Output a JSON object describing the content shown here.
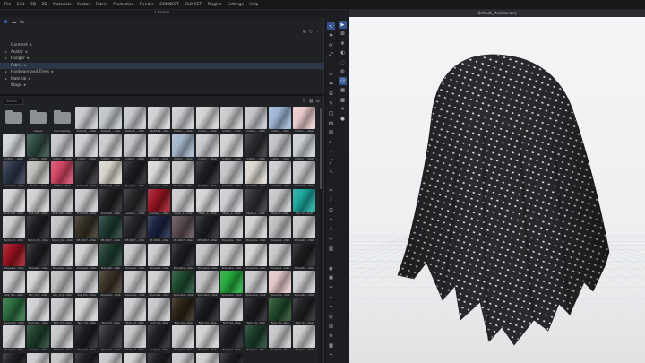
{
  "menu": [
    "File",
    "Edit",
    "3D",
    "2D",
    "Materials",
    "Avatar",
    "Fabric",
    "Production",
    "Render",
    "CONNECT",
    "CLO-SET",
    "Plugins",
    "Settings",
    "Help"
  ],
  "library": {
    "title": "Library",
    "tree": [
      {
        "label": "Garment",
        "expanded": false,
        "selected": false
      },
      {
        "label": "Avatar",
        "expanded": true,
        "selected": false
      },
      {
        "label": "Hanger",
        "expanded": true,
        "selected": false
      },
      {
        "label": "Fabric",
        "expanded": false,
        "selected": true
      },
      {
        "label": "Hardware and Trims",
        "expanded": true,
        "selected": false
      },
      {
        "label": "Material",
        "expanded": true,
        "selected": false
      },
      {
        "label": "Stage",
        "expanded": false,
        "selected": false
      }
    ],
    "search_placeholder": "Search",
    "items": [
      {
        "label": "..",
        "kind": "folder",
        "color": "#8d9093"
      },
      {
        "label": "Casual",
        "kind": "folder",
        "color": "#8d9093"
      },
      {
        "label": "Normal Map",
        "kind": "folder",
        "color": "#8d9093"
      },
      {
        "label": "Default_...zfab",
        "kind": "fabric",
        "color": "#c7c9cc"
      },
      {
        "label": "Default_...zfab",
        "kind": "fabric",
        "color": "#c2c5c8"
      },
      {
        "label": "Default_...zfab",
        "kind": "fabric",
        "color": "#c4c6c9"
      },
      {
        "label": "G6/8812...zfab",
        "kind": "fabric",
        "color": "#cfd1d3"
      },
      {
        "label": "Cotton_...zfab",
        "kind": "fabric",
        "color": "#c9cbce"
      },
      {
        "label": "Cotton_...zfab",
        "kind": "fabric",
        "color": "#d2d2d2"
      },
      {
        "label": "Cotton_...zfab",
        "kind": "fabric",
        "color": "#c7c9cb"
      },
      {
        "label": "Cotton_...zfab",
        "kind": "fabric",
        "color": "#c2c4c7"
      },
      {
        "label": "Cotton_...zfab",
        "kind": "fabric",
        "color": "#9db4d3"
      },
      {
        "label": "Cotton_...zfab",
        "kind": "fabric",
        "color": "#e8c9cb"
      },
      {
        "label": "Cotton_...zfab",
        "kind": "fabric",
        "color": "#cfd2d6"
      },
      {
        "label": "Cotton_...zfab",
        "kind": "fabric",
        "color": "#2f4a41"
      },
      {
        "label": "Cotton_...zfab",
        "kind": "fabric",
        "color": "#c3c5c8"
      },
      {
        "label": "Cotton_...zfab",
        "kind": "fabric",
        "color": "#cbcdd0"
      },
      {
        "label": "Cotton_...zfab",
        "kind": "fabric",
        "color": "#c7c9cb"
      },
      {
        "label": "Cotton_...zfab",
        "kind": "fabric",
        "color": "#c1c3c6"
      },
      {
        "label": "Cotton_...zfab",
        "kind": "fabric",
        "color": "#d0d2d4"
      },
      {
        "label": "Cotton_...zfab",
        "kind": "fabric",
        "color": "#a4b6c9"
      },
      {
        "label": "Cotton_...zfab",
        "kind": "fabric",
        "color": "#c6c8cb"
      },
      {
        "label": "Cotton_...zfab",
        "kind": "fabric",
        "color": "#cfcfcf"
      },
      {
        "label": "Cotton_...zfab",
        "kind": "fabric",
        "color": "#2b2c2f"
      },
      {
        "label": "Cotton_...zfab",
        "kind": "fabric",
        "color": "#bfc1c4"
      },
      {
        "label": "Cotton_...zfab",
        "kind": "fabric",
        "color": "#cacdd0"
      },
      {
        "label": "Denim_2...zfab",
        "kind": "fabric",
        "color": "#2c3447"
      },
      {
        "label": "DS Tec...zfab",
        "kind": "fabric",
        "color": "#bfbfb9"
      },
      {
        "label": "FEE19...zfab",
        "kind": "fabric",
        "color": "#d24563"
      },
      {
        "label": "Fabric_D...zfab",
        "kind": "fabric",
        "color": "#2a2a2e"
      },
      {
        "label": "Fabric_D...zfab",
        "kind": "fabric",
        "color": "#d6d3c8"
      },
      {
        "label": "Fur_Plus...zfab",
        "kind": "fabric",
        "color": "#1d1e21"
      },
      {
        "label": "Fur_Plus...zfab",
        "kind": "fabric",
        "color": "#d8d8d8"
      },
      {
        "label": "Fur_Plus...zfab",
        "kind": "fabric",
        "color": "#c4c4c4"
      },
      {
        "label": "Fur_Fab...zfab",
        "kind": "fabric",
        "color": "#1f2023"
      },
      {
        "label": "Knit Pati...zfab",
        "kind": "fabric",
        "color": "#c2c4c6"
      },
      {
        "label": "Knit Pati...zfab",
        "kind": "fabric",
        "color": "#d9d7cf"
      },
      {
        "label": "Knit Pati...zfab",
        "kind": "fabric",
        "color": "#c9cbcd"
      },
      {
        "label": "Knit Pati...zfab",
        "kind": "fabric",
        "color": "#c6c8ca"
      },
      {
        "label": "Knit Pati...zfab",
        "kind": "fabric",
        "color": "#d0d2d4"
      },
      {
        "label": "Knit Pati...zfab",
        "kind": "fabric",
        "color": "#cfcfcf"
      },
      {
        "label": "Knit Pati...zfab",
        "kind": "fabric",
        "color": "#bfc1c3"
      },
      {
        "label": "Knit Pati...zfab",
        "kind": "fabric",
        "color": "#c8cacc"
      },
      {
        "label": "Knit Pati...zfab",
        "kind": "fabric",
        "color": "#1d1f21"
      },
      {
        "label": "Leather_...zfab",
        "kind": "fabric",
        "color": "#28292b"
      },
      {
        "label": "Leather_...zfab",
        "kind": "fabric",
        "color": "#9a1522"
      },
      {
        "label": "Mesh_L...zfab",
        "kind": "fabric",
        "color": "#c8cacb"
      },
      {
        "label": "Mesh_L...zfab",
        "kind": "fabric",
        "color": "#d2d2d2"
      },
      {
        "label": "Mesh_L...zfab",
        "kind": "fabric",
        "color": "#cccdd0"
      },
      {
        "label": "Mesh_L...zfab",
        "kind": "fabric",
        "color": "#2d2e31"
      },
      {
        "label": "Mesh_F...zfab",
        "kind": "fabric",
        "color": "#c4c6c8"
      },
      {
        "label": "Neo Pl...zfab",
        "kind": "fabric",
        "color": "#1aa59b"
      },
      {
        "label": "Nylon_C...zfab",
        "kind": "fabric",
        "color": "#c9cbcc"
      },
      {
        "label": "Nylon_Pe...zfab",
        "kind": "fabric",
        "color": "#1e1f22"
      },
      {
        "label": "Nylon_Pe...zfab",
        "kind": "fabric",
        "color": "#c1c3c5"
      },
      {
        "label": "PE-0607...zfab",
        "kind": "fabric",
        "color": "#353024"
      },
      {
        "label": "PE-0607...zfab",
        "kind": "fabric",
        "color": "#1e3a32"
      },
      {
        "label": "PE-0607...zfab",
        "kind": "fabric",
        "color": "#23252a"
      },
      {
        "label": "PE-0609...zfab",
        "kind": "fabric",
        "color": "#1b2340"
      },
      {
        "label": "PE-0607...zfab",
        "kind": "fabric",
        "color": "#5b4e53"
      },
      {
        "label": "PE-0607...zfab",
        "kind": "fabric",
        "color": "#1d1f22"
      },
      {
        "label": "Polyeste...zfab",
        "kind": "fabric",
        "color": "#c7c9cb"
      },
      {
        "label": "Polyeste...zfab",
        "kind": "fabric",
        "color": "#d1d1d1"
      },
      {
        "label": "Polyeste...zfab",
        "kind": "fabric",
        "color": "#bbbdbf"
      },
      {
        "label": "Polyeste...zfab",
        "kind": "fabric",
        "color": "#c6c6c6"
      },
      {
        "label": "Polyeste...zfab",
        "kind": "fabric",
        "color": "#9b1220"
      },
      {
        "label": "Polyeste...zfab",
        "kind": "fabric",
        "color": "#1d1e21"
      },
      {
        "label": "Polyeste...zfab",
        "kind": "fabric",
        "color": "#c8cacc"
      },
      {
        "label": "Polyeste...zfab",
        "kind": "fabric",
        "color": "#d0d0d0"
      },
      {
        "label": "Polyeste...zfab",
        "kind": "fabric",
        "color": "#1e3b2f"
      },
      {
        "label": "Polyeste...zfab",
        "kind": "fabric",
        "color": "#c6c8ca"
      },
      {
        "label": "Polyeste...zfab",
        "kind": "fabric",
        "color": "#c9cbcd"
      },
      {
        "label": "Polyeste...zfab",
        "kind": "fabric",
        "color": "#1e1f22"
      },
      {
        "label": "Polyeste...zfab",
        "kind": "fabric",
        "color": "#c2c4c6"
      },
      {
        "label": "Polyeste...zfab",
        "kind": "fabric",
        "color": "#cacaca"
      },
      {
        "label": "Polyeste...zfab",
        "kind": "fabric",
        "color": "#d3d3d3"
      },
      {
        "label": "Polyeste...zfab",
        "kind": "fabric",
        "color": "#c5c7c9"
      },
      {
        "label": "Polyeste...zfab",
        "kind": "fabric",
        "color": "#1d1e20"
      },
      {
        "label": "Silk_Pla...zfab",
        "kind": "fabric",
        "color": "#c9cbcd"
      },
      {
        "label": "Silk_Org...zfab",
        "kind": "fabric",
        "color": "#d4d4d4"
      },
      {
        "label": "Silk_Org...zfab",
        "kind": "fabric",
        "color": "#bebebe"
      },
      {
        "label": "Silk_Pla...zfab",
        "kind": "fabric",
        "color": "#c6c8ca"
      },
      {
        "label": "Spandex...zfab",
        "kind": "fabric",
        "color": "#3a3327"
      },
      {
        "label": "Spandex...zfab",
        "kind": "fabric",
        "color": "#c8cacc"
      },
      {
        "label": "Spandex...zfab",
        "kind": "fabric",
        "color": "#cfcfcf"
      },
      {
        "label": "Spandex...zfab",
        "kind": "fabric",
        "color": "#1e4b2e"
      },
      {
        "label": "Spandex...zfab",
        "kind": "fabric",
        "color": "#c2c2c2"
      },
      {
        "label": "Spandex...zfab",
        "kind": "fabric",
        "color": "#23a83a"
      },
      {
        "label": "Spandex...zfab",
        "kind": "fabric",
        "color": "#c7c9cb"
      },
      {
        "label": "Spandex...zfab",
        "kind": "fabric",
        "color": "#e2c6c8"
      },
      {
        "label": "Spandex...zfab",
        "kind": "fabric",
        "color": "#cbcdcf"
      },
      {
        "label": "Spandex...zfab",
        "kind": "fabric",
        "color": "#2a6c3d"
      },
      {
        "label": "Spandex...zfab",
        "kind": "fabric",
        "color": "#cfd1d3"
      },
      {
        "label": "Twill_Sil...zfab",
        "kind": "fabric",
        "color": "#c5c7c9"
      },
      {
        "label": "Twill_Sil...zfab",
        "kind": "fabric",
        "color": "#d3d3d3"
      },
      {
        "label": "Twill_Sil...zfab",
        "kind": "fabric",
        "color": "#1e1f22"
      },
      {
        "label": "Twill_Sil...zfab",
        "kind": "fabric",
        "color": "#c7c9cb"
      },
      {
        "label": "Twill_Sil...zfab",
        "kind": "fabric",
        "color": "#c3c5c7"
      },
      {
        "label": "Twill_Sil...zfab",
        "kind": "fabric",
        "color": "#2b2215"
      },
      {
        "label": "Twill_Sil...zfab",
        "kind": "fabric",
        "color": "#1b1c1f"
      },
      {
        "label": "Twill_Sil...zfab",
        "kind": "fabric",
        "color": "#c6c8ca"
      },
      {
        "label": "Twill_Sil...zfab",
        "kind": "fabric",
        "color": "#1c1d20"
      },
      {
        "label": "Twill_Sil...zfab",
        "kind": "fabric",
        "color": "#214a2a"
      },
      {
        "label": "Twill_Sil...zfab",
        "kind": "fabric",
        "color": "#1e2022"
      },
      {
        "label": "Twill_Sil...zfab",
        "kind": "fabric",
        "color": "#cbcdcf"
      },
      {
        "label": "Twill_Sil...zfab",
        "kind": "fabric",
        "color": "#1d3d2b"
      },
      {
        "label": "Twill_Sil...zfab",
        "kind": "fabric",
        "color": "#c4c6c8"
      },
      {
        "label": "Twill_Sil...zfab",
        "kind": "fabric",
        "color": "#1b1c1f"
      },
      {
        "label": "Twill_Sil...zfab",
        "kind": "fabric",
        "color": "#2c2d30"
      },
      {
        "label": "Twill_Sil...zfab",
        "kind": "fabric",
        "color": "#c2c4c6"
      },
      {
        "label": "Twill_Sil...zfab",
        "kind": "fabric",
        "color": "#1f2023"
      },
      {
        "label": "Twill_Sil...zfab",
        "kind": "fabric",
        "color": "#c8cacc"
      },
      {
        "label": "Twill_Sil...zfab",
        "kind": "fabric",
        "color": "#d0d0d0"
      },
      {
        "label": "Twill_Sil...zfab",
        "kind": "fabric",
        "color": "#1d1e21"
      },
      {
        "label": "Twill_Sil...zfab",
        "kind": "fabric",
        "color": "#1d3d2b"
      },
      {
        "label": "Twill_Sil...zfab",
        "kind": "fabric",
        "color": "#c3c5c7"
      },
      {
        "label": "Twill_Sil...zfab",
        "kind": "fabric",
        "color": "#cbcbcb"
      },
      {
        "label": "Twill_Sil...zfab",
        "kind": "fabric",
        "color": "#1f2023"
      },
      {
        "label": "Twill_Sil...zfab",
        "kind": "fabric",
        "color": "#c9cbcd"
      },
      {
        "label": "Twill_Sil...zfab",
        "kind": "fabric",
        "color": "#c2c2c2"
      },
      {
        "label": "Twill_Sil...zfab",
        "kind": "fabric",
        "color": "#1e1f22"
      },
      {
        "label": "Twill_Sil...zfab",
        "kind": "fabric",
        "color": "#c6c8ca"
      },
      {
        "label": "Twill_Sil...zfab",
        "kind": "fabric",
        "color": "#d1d1d1"
      },
      {
        "label": "Twill_Sil...zfab",
        "kind": "fabric",
        "color": "#1d1e21"
      },
      {
        "label": "Twill_Sil...zfab",
        "kind": "fabric",
        "color": "#c4c6c8"
      },
      {
        "label": "Twill_Sil...zfab",
        "kind": "fabric",
        "color": "#cdcdcd"
      },
      {
        "label": "Twill_Sil...zfab",
        "kind": "fabric",
        "color": "#1e1f22"
      }
    ]
  },
  "viewport": {
    "title": "Default_Modular.zprj"
  },
  "toolbar_a": [
    "cursor-icon",
    "move-icon",
    "rotate-icon",
    "scale-icon",
    "transform-icon",
    "fold-icon",
    "pin-icon",
    "tape-icon",
    "brush-icon",
    "select-icon",
    "sew-icon",
    "arrange-icon",
    "measure-icon",
    "point-icon",
    "line-icon",
    "curve-icon",
    "trace-icon",
    "slice-icon",
    "split-icon",
    "internal-icon",
    "notch-icon",
    "grain-icon",
    "trim-icon",
    "texture-icon",
    "zipper-icon",
    "button-icon",
    "graphic-icon",
    "puckering-icon",
    "topstitch-icon",
    "seam-icon",
    "piping-icon",
    "fitmap-icon",
    "tension-icon",
    "stress-icon",
    "camera-icon"
  ],
  "toolbar_b": [
    "simulate-icon",
    "lock-icon",
    "freeze-icon",
    "shadow-icon",
    "hide-icon",
    "show-icon",
    "avatar-icon",
    "wireframe-icon",
    "texture-view-icon",
    "light-icon",
    "render-icon"
  ]
}
